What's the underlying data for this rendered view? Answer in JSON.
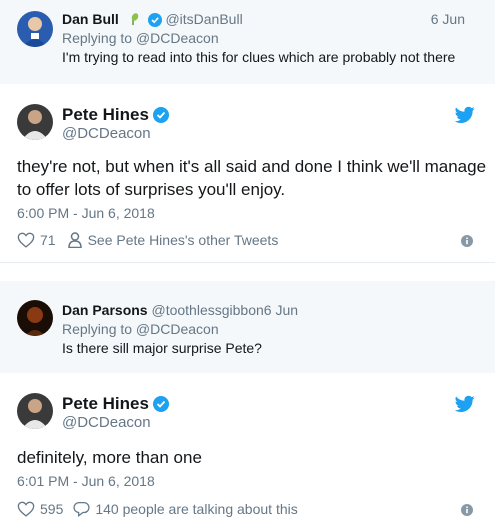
{
  "reply1": {
    "name": "Dan Bull",
    "handle": "@itsDanBull",
    "time": "6 Jun",
    "replying": "Replying to @DCDeacon",
    "text": "I'm trying to read into this for clues which are probably not there"
  },
  "tweet1": {
    "name": "Pete Hines",
    "handle": "@DCDeacon",
    "text": "they're not, but when it's all said and done I think we'll manage to offer lots of surprises you'll enjoy.",
    "timestamp": "6:00 PM - Jun 6, 2018",
    "likes": "71",
    "other_tweets": "See Pete Hines's other Tweets"
  },
  "reply2": {
    "name": "Dan Parsons",
    "handle": "@toothlessgibbon",
    "time": "6 Jun",
    "replying": "Replying to @DCDeacon",
    "text": "Is there sill major surprise Pete?"
  },
  "tweet2": {
    "name": "Pete Hines",
    "handle": "@DCDeacon",
    "text": "definitely, more than one",
    "timestamp": "6:01 PM - Jun 6, 2018",
    "likes": "595",
    "talking": "140 people are talking about this"
  },
  "colors": {
    "twitter_blue": "#1da1f2",
    "muted": "#657786",
    "reply_bg": "#f5f8fa"
  },
  "icons": [
    "verified-icon",
    "twitter-bird-icon",
    "heart-icon",
    "person-icon",
    "comment-icon",
    "info-icon",
    "plant-emoji-icon"
  ]
}
